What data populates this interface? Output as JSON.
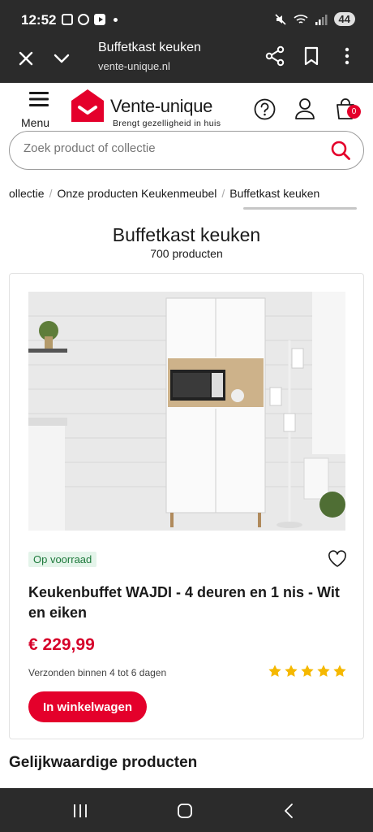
{
  "status_bar": {
    "time": "12:52",
    "battery": "44"
  },
  "browser": {
    "title": "Buffetkast keuken",
    "url": "vente-unique.nl"
  },
  "header": {
    "menu_label": "Menu",
    "logo_name": "Vente-unique",
    "logo_tagline": "Brengt gezelligheid in huis",
    "cart_count": "0",
    "brand_color": "#e4002b"
  },
  "search": {
    "placeholder": "Zoek product of collectie"
  },
  "breadcrumb": [
    "ollectie",
    "Onze producten Keukenmeubel",
    "Buffetkast keuken"
  ],
  "page": {
    "title": "Buffetkast keuken",
    "count": "700 producten"
  },
  "product": {
    "stock": "Op voorraad",
    "name": "Keukenbuffet WAJDI - 4 deuren en 1 nis - Wit en eiken",
    "price": "€ 229,99",
    "delivery": "Verzonden binnen 4 tot 6 dagen",
    "rating": 5,
    "cta": "In winkelwagen"
  },
  "similar": {
    "heading": "Gelijkwaardige producten"
  }
}
